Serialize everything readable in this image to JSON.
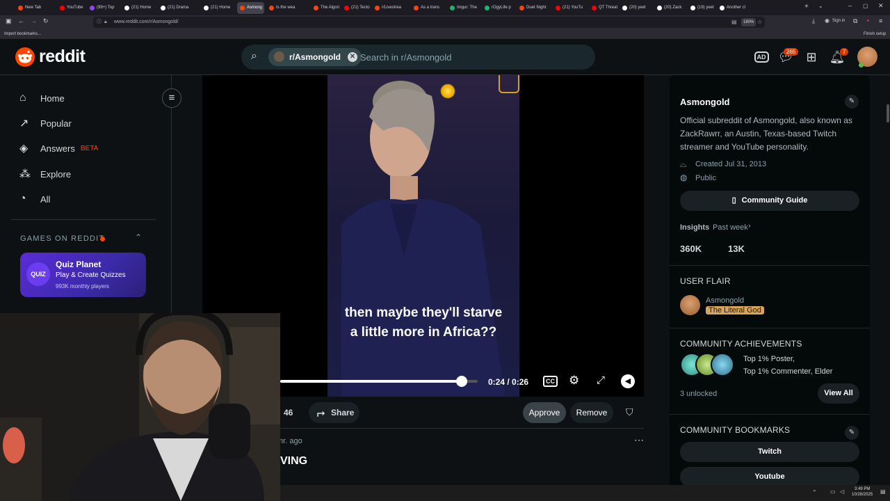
{
  "browser": {
    "tabs": [
      {
        "label": "New Tab",
        "color": "#ff4500"
      },
      {
        "label": "YouTube",
        "color": "#ff0000"
      },
      {
        "label": "(99+) Top",
        "color": "#9146ff"
      },
      {
        "label": "(21) Home",
        "color": "#ffffff"
      },
      {
        "label": "(21) Drama",
        "color": "#ffffff"
      },
      {
        "label": "(21) Home",
        "color": "#ffffff"
      },
      {
        "label": "Asmong",
        "color": "#ff4500",
        "active": true
      },
      {
        "label": "Is the wea",
        "color": "#ff4500"
      },
      {
        "label": "The Algori",
        "color": "#ff4500"
      },
      {
        "label": "(21) Tecto",
        "color": "#ff0000"
      },
      {
        "label": "r/Livestrea",
        "color": "#ff4500"
      },
      {
        "label": "As a trans",
        "color": "#ff4500"
      },
      {
        "label": "Imgur: The",
        "color": "#1bb76e"
      },
      {
        "label": "rOgyLife p",
        "color": "#1bb76e"
      },
      {
        "label": "Duet Night",
        "color": "#ff4500"
      },
      {
        "label": "(21) YouTu",
        "color": "#ff0000"
      },
      {
        "label": "QT Threats",
        "color": "#ff0000"
      },
      {
        "label": "(20) yeet",
        "color": "#ffffff"
      },
      {
        "label": "(20) Zack",
        "color": "#ffffff"
      },
      {
        "label": "(19) yeet",
        "color": "#ffffff"
      },
      {
        "label": "Another cl",
        "color": "#ffffff"
      }
    ],
    "url": "www.reddit.com/r/Asmongold/",
    "zoom": "180%",
    "sign_in": "Sign in",
    "import_bookmarks": "Import bookmarks...",
    "finish_setup": "Finish setup"
  },
  "header": {
    "logo_text": "reddit",
    "search_chip": "r/Asmongold",
    "search_placeholder": "Search in r/Asmongold",
    "chat_badge": "265",
    "notif_badge": "7"
  },
  "sidebar": {
    "items": [
      {
        "label": "Home",
        "icon": "home-icon"
      },
      {
        "label": "Popular",
        "icon": "popular-icon"
      },
      {
        "label": "Answers",
        "icon": "answers-icon",
        "tag": "BETA"
      },
      {
        "label": "Explore",
        "icon": "explore-icon"
      },
      {
        "label": "All",
        "icon": "all-icon"
      }
    ],
    "games_heading": "GAMES ON REDDIT",
    "game": {
      "badge": "QUIZ",
      "title": "Quiz Planet",
      "subtitle": "Play & Create Quizzes",
      "players": "993K monthly players"
    }
  },
  "video": {
    "subtitle_line1": "then maybe they'll starve",
    "subtitle_line2": "a little more in Africa??",
    "time": "0:24 / 0:26",
    "progress": 0.92
  },
  "post": {
    "vote_count": "46",
    "share": "Share",
    "approve": "Approve",
    "remove": "Remove",
    "age": "mr. ago",
    "title_fragment": "VING"
  },
  "right": {
    "name": "Asmongold",
    "description": "Official subreddit of Asmongold, also known as ZackRawrr, an Austin, Texas-based Twitch streamer and YouTube personality.",
    "created": "Created Jul 31, 2013",
    "visibility": "Public",
    "guide_button": "Community Guide",
    "insights_label": "Insights",
    "insights_period": "Past week",
    "stat1": "360K",
    "stat2": "13K",
    "user_flair_heading": "USER FLAIR",
    "flair_user": "Asmongold",
    "flair_tag": "The Literal God",
    "achievements_heading": "COMMUNITY ACHIEVEMENTS",
    "achievement_line1": "Top 1% Poster,",
    "achievement_line2": "Top 1% Commenter, Elder",
    "unlocked": "3 unlocked",
    "view_all": "View All",
    "bookmarks_heading": "COMMUNITY BOOKMARKS",
    "bookmark1": "Twitch",
    "bookmark2": "Youtube"
  },
  "taskbar": {
    "time": "3:49 PM",
    "date": "10/28/2025"
  }
}
